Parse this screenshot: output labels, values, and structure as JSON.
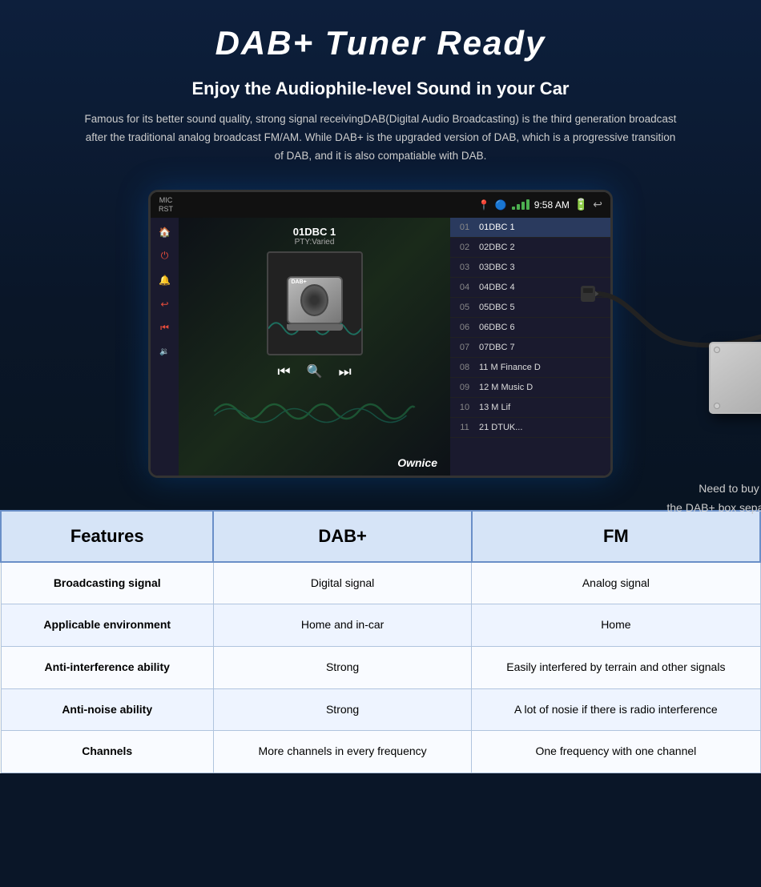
{
  "header": {
    "main_title": "DAB+ Tuner Ready",
    "subtitle": "Enjoy the Audiophile-level Sound in your Car",
    "description": "Famous for its better sound quality, strong signal receivingDAB(Digital Audio Broadcasting) is the third generation broadcast after the traditional analog broadcast FM/AM. While DAB+ is the upgraded version of DAB, which is a progressive transition of DAB, and it is also compatiable with DAB."
  },
  "device": {
    "top_bar": {
      "mic_label": "MIC",
      "rst_label": "RST",
      "time": "9:58 AM"
    },
    "station": "01DBC 1",
    "pty": "PTY:Varied",
    "dab_badge": "DAB+",
    "ownice": "Ownice",
    "channels": [
      {
        "num": "01",
        "name": "01DBC 1",
        "active": true
      },
      {
        "num": "02",
        "name": "02DBC 2",
        "active": false
      },
      {
        "num": "03",
        "name": "03DBC 3",
        "active": false
      },
      {
        "num": "04",
        "name": "04DBC 4",
        "active": false
      },
      {
        "num": "05",
        "name": "05DBC 5",
        "active": false
      },
      {
        "num": "06",
        "name": "06DBC 6",
        "active": false
      },
      {
        "num": "07",
        "name": "07DBC 7",
        "active": false
      },
      {
        "num": "08",
        "name": "11 M Finance D",
        "active": false
      },
      {
        "num": "09",
        "name": "12 M Music D",
        "active": false
      },
      {
        "num": "10",
        "name": "13 M Lif",
        "active": false
      },
      {
        "num": "11",
        "name": "21 DTUK...",
        "active": false
      }
    ]
  },
  "dab_box": {
    "label_line1": "Need to buy",
    "label_line2": "the DAB+ box separately"
  },
  "table": {
    "headers": {
      "features": "Features",
      "dab": "DAB+",
      "fm": "FM"
    },
    "rows": [
      {
        "feature": "Broadcasting signal",
        "dab": "Digital signal",
        "fm": "Analog signal"
      },
      {
        "feature": "Applicable environment",
        "dab": "Home and in-car",
        "fm": "Home"
      },
      {
        "feature": "Anti-interference ability",
        "dab": "Strong",
        "fm": "Easily interfered by terrain and other signals"
      },
      {
        "feature": "Anti-noise ability",
        "dab": "Strong",
        "fm": "A lot of nosie if there is radio interference"
      },
      {
        "feature": "Channels",
        "dab": "More channels in every frequency",
        "fm": "One frequency with one channel"
      }
    ]
  }
}
